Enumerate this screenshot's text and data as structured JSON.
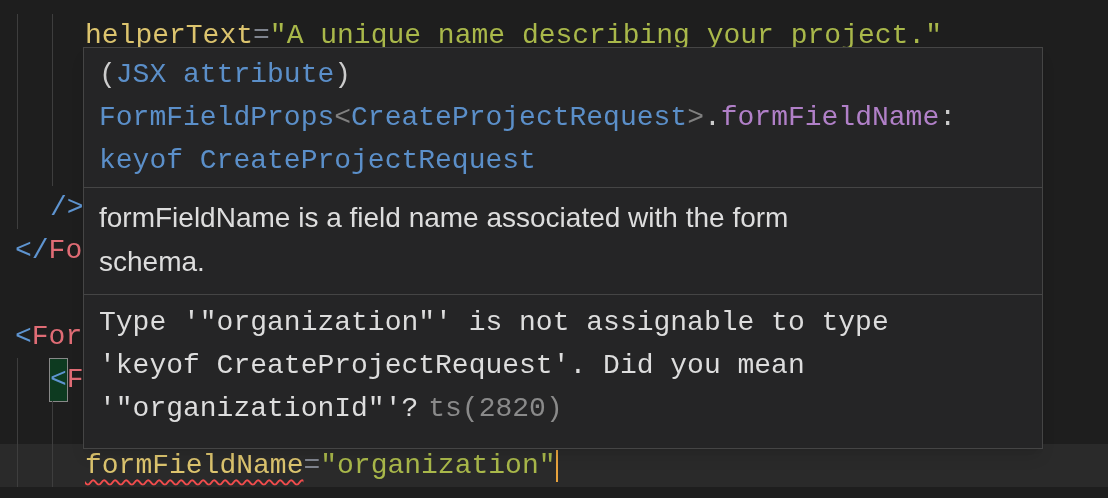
{
  "editor": {
    "lines": [
      {
        "kind": "deep",
        "tokens": [
          {
            "kind": "attribute",
            "text": "helperText"
          },
          {
            "kind": "operator",
            "text": "="
          },
          {
            "kind": "string",
            "text": "\"A unique name describing your project.\""
          }
        ]
      },
      {
        "kind": "deep"
      },
      {
        "kind": "deep"
      },
      {
        "kind": "deep"
      },
      {
        "kind": "nested",
        "tokens": [
          {
            "kind": "bracket",
            "text": "/>"
          }
        ]
      },
      {
        "kind": "top",
        "tokens": [
          {
            "kind": "bracket",
            "text": "</"
          },
          {
            "kind": "tag",
            "text": "Fo"
          }
        ]
      },
      {
        "kind": "top"
      },
      {
        "kind": "top",
        "tokens": [
          {
            "kind": "bracket",
            "text": "<"
          },
          {
            "kind": "tag",
            "text": "For"
          }
        ]
      },
      {
        "kind": "nested",
        "tokens": [
          {
            "kind": "bracket",
            "text": "<",
            "matched": true
          },
          {
            "kind": "tag",
            "text": "F"
          }
        ]
      },
      {
        "kind": "deep"
      },
      {
        "kind": "deep",
        "current": true,
        "cursor": true,
        "tokens": [
          {
            "kind": "attribute",
            "text": "formFieldName",
            "error": true
          },
          {
            "kind": "operator",
            "text": "="
          },
          {
            "kind": "string",
            "text": "\"organization\""
          }
        ]
      }
    ]
  },
  "hover": {
    "signature": [
      [
        {
          "kind": "plain",
          "text": "("
        },
        {
          "kind": "keyword",
          "text": "JSX attribute"
        },
        {
          "kind": "plain",
          "text": ")"
        }
      ],
      [
        {
          "kind": "type",
          "text": "FormFieldProps"
        },
        {
          "kind": "punctuation",
          "text": "<"
        },
        {
          "kind": "type",
          "text": "CreateProjectRequest"
        },
        {
          "kind": "punctuation",
          "text": ">"
        },
        {
          "kind": "plain",
          "text": "."
        },
        {
          "kind": "property",
          "text": "formFieldName"
        },
        {
          "kind": "plain",
          "text": ":"
        }
      ],
      [
        {
          "kind": "keyword",
          "text": "keyof"
        },
        {
          "kind": "type",
          "text": "CreateProjectRequest"
        }
      ]
    ],
    "documentation": "formFieldName is a field name associated with the form schema.",
    "error": {
      "message": "Type '\"organization\"' is not assignable to type 'keyof CreateProjectRequest'. Did you mean '\"organizationId\"'?",
      "code": "ts(2820)"
    }
  }
}
